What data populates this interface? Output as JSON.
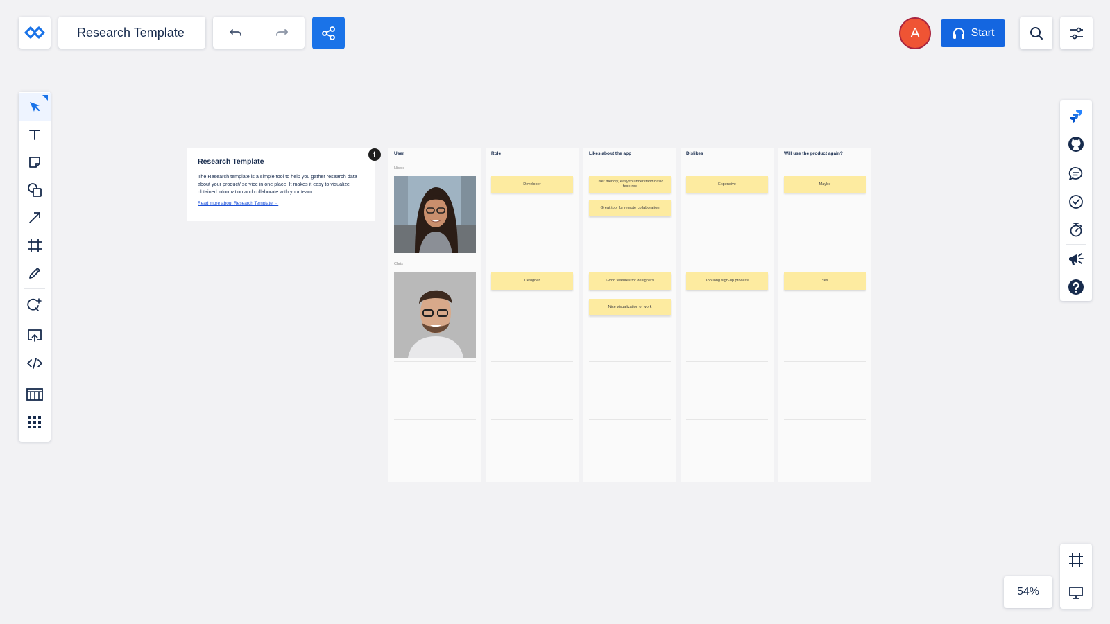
{
  "app": {
    "board_title": "Research Template",
    "user_initial": "A",
    "start_label": "Start",
    "zoom": "54%",
    "accent": "#1a73e8"
  },
  "icons": {
    "top": [
      "logo-icon",
      "undo-icon",
      "redo-icon",
      "share-icon",
      "headphones-icon",
      "search-icon",
      "sliders-icon"
    ],
    "toolbar": [
      "select-icon",
      "text-icon",
      "sticky-note-icon",
      "shapes-icon",
      "arrow-icon",
      "frame-icon",
      "pen-icon",
      "lasso-icon",
      "upload-icon",
      "embed-icon",
      "table-icon",
      "apps-icon"
    ],
    "rail": [
      "jira-icon",
      "github-icon",
      "comment-icon",
      "checklist-icon",
      "timer-icon",
      "announce-icon",
      "help-icon"
    ],
    "bottom": [
      "frame-icon",
      "present-icon"
    ]
  },
  "info_card": {
    "title": "Research Template",
    "body": "The Research template is a simple tool to help you gather research data about your product/ service in one place. It makes it easy to visualize obtained information and collaborate with your team.",
    "link": "Read more about Research Template →",
    "badge": "i"
  },
  "table": {
    "headers": [
      "User",
      "Role",
      "Likes about the app",
      "Dislikes",
      "Will use the product again?"
    ],
    "rows": [
      {
        "user": "Nicole",
        "role": "Developer",
        "likes": [
          "User friendly, easy to understand basic features",
          "Great tool for remote collaboration"
        ],
        "dislikes": "Expensive",
        "again": "Maybe"
      },
      {
        "user": "Chris",
        "role": "Designer",
        "likes": [
          "Good features for designers",
          "Nice visualization of work"
        ],
        "dislikes": "Too long sign-up process",
        "again": "Yes"
      }
    ],
    "sticky_color": "#fdeba0"
  }
}
